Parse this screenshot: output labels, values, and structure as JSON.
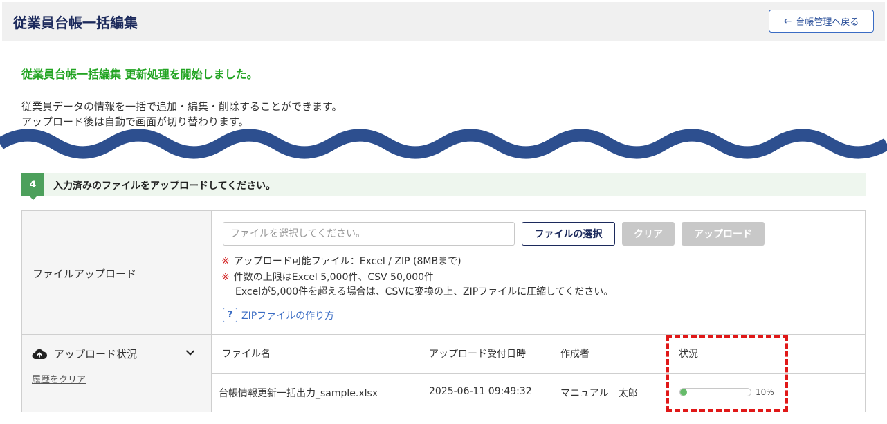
{
  "header": {
    "title": "従業員台帳一括編集",
    "back_label": "台帳管理へ戻る"
  },
  "message": {
    "success": "従業員台帳一括編集 更新処理を開始しました。",
    "desc_line1": "従業員データの情報を一括で追加・編集・削除することができます。",
    "desc_line2": "アップロード後は自動で画面が切り替わります。"
  },
  "step": {
    "number": "4",
    "text": "入力済みのファイルをアップロードしてください。"
  },
  "upload": {
    "label": "ファイルアップロード",
    "placeholder": "ファイルを選択してください。",
    "select_label": "ファイルの選択",
    "clear_label": "クリア",
    "upload_label": "アップロード",
    "note_mark": "※",
    "note1": "アップロード可能ファイル：Excel / ZIP (8MBまで)",
    "note2": "件数の上限はExcel 5,000件、CSV 50,000件",
    "note3": "Excelが5,000件を超える場合は、CSVに変換の上、ZIPファイルに圧縮してください。",
    "help_mark": "?",
    "help_link": "ZIPファイルの作り方"
  },
  "status": {
    "label": "アップロード状況",
    "clear_history": "履歴をクリア",
    "columns": {
      "file": "ファイル名",
      "date": "アップロード受付日時",
      "author": "作成者",
      "status": "状況"
    },
    "row": {
      "file": "台帳情報更新一括出力_sample.xlsx",
      "date": "2025-06-11 09:49:32",
      "author": "マニュアル　太郎",
      "progress": 0.1,
      "progress_label": "10%"
    }
  },
  "colors": {
    "brand_navy": "#1c2a5c",
    "success_green": "#22a422",
    "step_green": "#4da05c",
    "wave_blue": "#2d4f8f",
    "highlight_red": "#e01818",
    "progress_green": "#66bb6a"
  }
}
